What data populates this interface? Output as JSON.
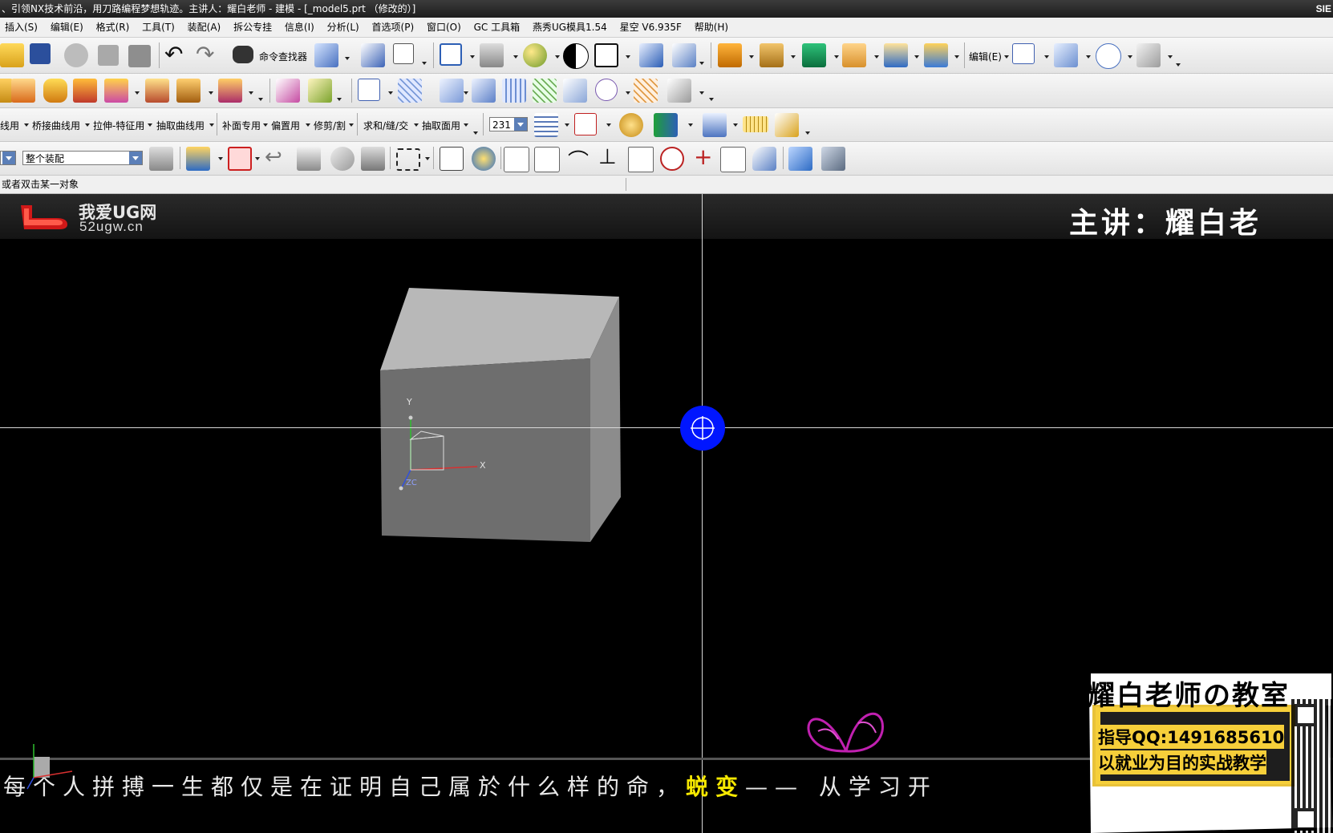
{
  "window": {
    "title": "、引领NX技术前沿，用刀路编程梦想轨迹。主讲人：耀白老师 - 建模 - [_model5.prt （修改的）]",
    "brand_right": "SIE"
  },
  "menu": [
    "插入(S)",
    "编辑(E)",
    "格式(R)",
    "工具(T)",
    "装配(A)",
    "拆公专挂",
    "信息(I)",
    "分析(L)",
    "首选项(P)",
    "窗口(O)",
    "GC 工具箱",
    "燕秀UG模具1.54",
    "星空 V6.935F",
    "帮助(H)"
  ],
  "toolbar1": {
    "command_finder": "命令查找器",
    "edit_menu": "编辑(E)"
  },
  "toolbar3": {
    "menus": [
      "线用",
      "桥接曲线用",
      "拉伸-特征用",
      "抽取曲线用",
      "补面专用",
      "偏置用",
      "修剪/割",
      "求和/缝/交",
      "抽取面用"
    ],
    "layer_value": "231"
  },
  "toolbar4": {
    "assembly_filter": "整个装配"
  },
  "status": {
    "prompt": "或者双击某一对象"
  },
  "viewport": {
    "logo_cn": "我爱UG网",
    "logo_url": "52ugw.cn",
    "presenter": "主讲：耀白老",
    "triad": {
      "y": "Y",
      "x": "X",
      "zc": "ZC"
    },
    "subtitle_main": "每个人拼搏一生都仅是在证明自己属於什么样的命，",
    "subtitle_highlight": "蜕变",
    "subtitle_tail": "—— 从学习开",
    "card_title": "耀白老师の教室",
    "card_qq": "指导QQ:1491685610",
    "card_slogan": "以就业为目的实战教学",
    "colors": {
      "cube_front": "#6e6e6e",
      "cube_top": "#b8b8b8",
      "cube_side": "#8c8c8c",
      "crosshair": "#0000ff",
      "highlight": "#f6e800"
    }
  }
}
